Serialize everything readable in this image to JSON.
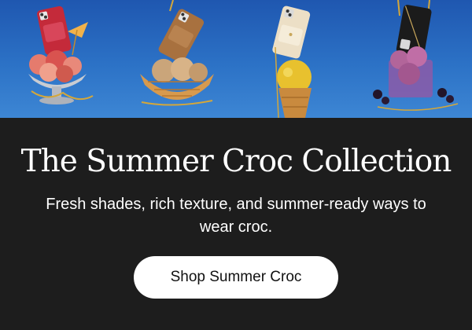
{
  "hero": {
    "panels": [
      {
        "name": "red-croc-phone-case-sundae",
        "icon": "phone-case-red-croc-in-ice-cream-sundae"
      },
      {
        "name": "tan-croc-phone-case-waffle-bowl",
        "icon": "phone-case-tan-croc-in-waffle-bowl"
      },
      {
        "name": "white-croc-phone-case-cone",
        "icon": "phone-case-white-croc-on-ice-cream-cone"
      },
      {
        "name": "black-croc-phone-case-berries",
        "icon": "phone-case-black-croc-with-berry-sorbet"
      }
    ],
    "background_color": "#2c6fc4"
  },
  "headline": "The Summer Croc Collection",
  "subcopy": "Fresh shades, rich texture, and summer-ready ways to wear croc.",
  "cta": {
    "label": "Shop Summer Croc"
  },
  "colors": {
    "background": "#1d1d1d",
    "text": "#ffffff",
    "button_bg": "#ffffff",
    "button_text": "#111111"
  }
}
